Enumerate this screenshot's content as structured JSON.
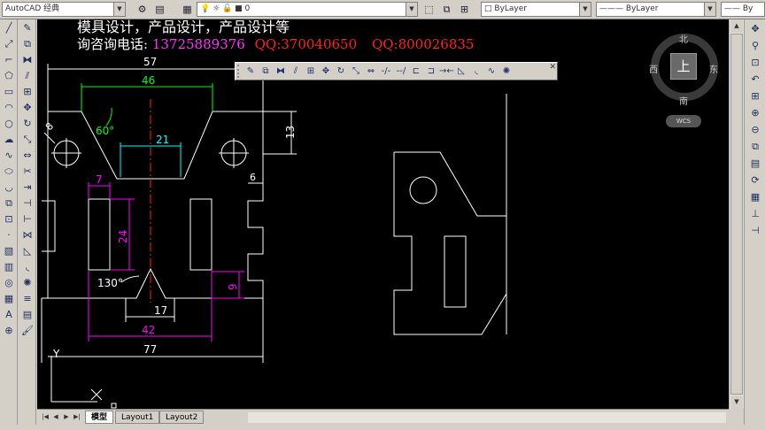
{
  "window": {
    "workspace_combo": "AutoCAD 经典",
    "layer_combo": "0",
    "color_combo": "ByLayer",
    "linetype_combo": "ByLayer",
    "lineweight_combo": "By"
  },
  "promo": {
    "line1": "模具设计，产品设计，产品设计等",
    "line2_label": "询咨询电话:",
    "line2_phone": "13725889376",
    "line2_qq1": "QQ:370040650",
    "line2_qq2": "QQ:800026835"
  },
  "compass": {
    "north": "北",
    "south": "南",
    "east": "东",
    "west": "西",
    "top": "上",
    "wcs": "WCS"
  },
  "drawing": {
    "dims": {
      "d57": "57",
      "d46": "46",
      "d21": "21",
      "d60": "60°",
      "d13": "13",
      "d8": "8",
      "d7": "7",
      "d6": "6",
      "d24": "24",
      "d130": "130°",
      "d9": "9",
      "d17": "17",
      "d42": "42",
      "d77": "77"
    },
    "ucs": {
      "y": "Y",
      "x": "X"
    }
  },
  "tabs": [
    "模型",
    "Layout1",
    "Layout2"
  ],
  "colors": {
    "canvas": "#000000",
    "geometry": "#ffffff",
    "dim_white": "#ffffff",
    "dim_green": "#00ff00",
    "dim_cyan": "#00ffff",
    "dim_magenta": "#ff00ff",
    "centerline": "#ff2020"
  }
}
